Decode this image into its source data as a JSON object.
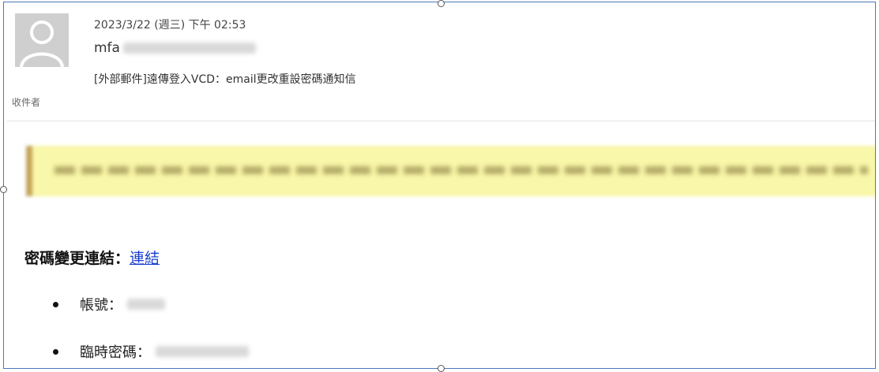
{
  "email": {
    "date": "2023/3/22 (週三) 下午 02:53",
    "sender_prefix": "mfa",
    "subject": "[外部郵件]遠傳登入VCD：email更改重設密碼通知信",
    "recipient_label": "收件者"
  },
  "body": {
    "password_change_label": "密碼變更連結：",
    "password_change_link": "連結",
    "items": [
      {
        "label": "帳號："
      },
      {
        "label": "臨時密碼："
      }
    ]
  },
  "icons": {
    "avatar": "default-avatar-icon"
  },
  "colors": {
    "frame_border": "#4a78b8",
    "banner_background": "#f9f7a9",
    "banner_accent": "#c3a55a",
    "link": "#1a3fd0"
  }
}
